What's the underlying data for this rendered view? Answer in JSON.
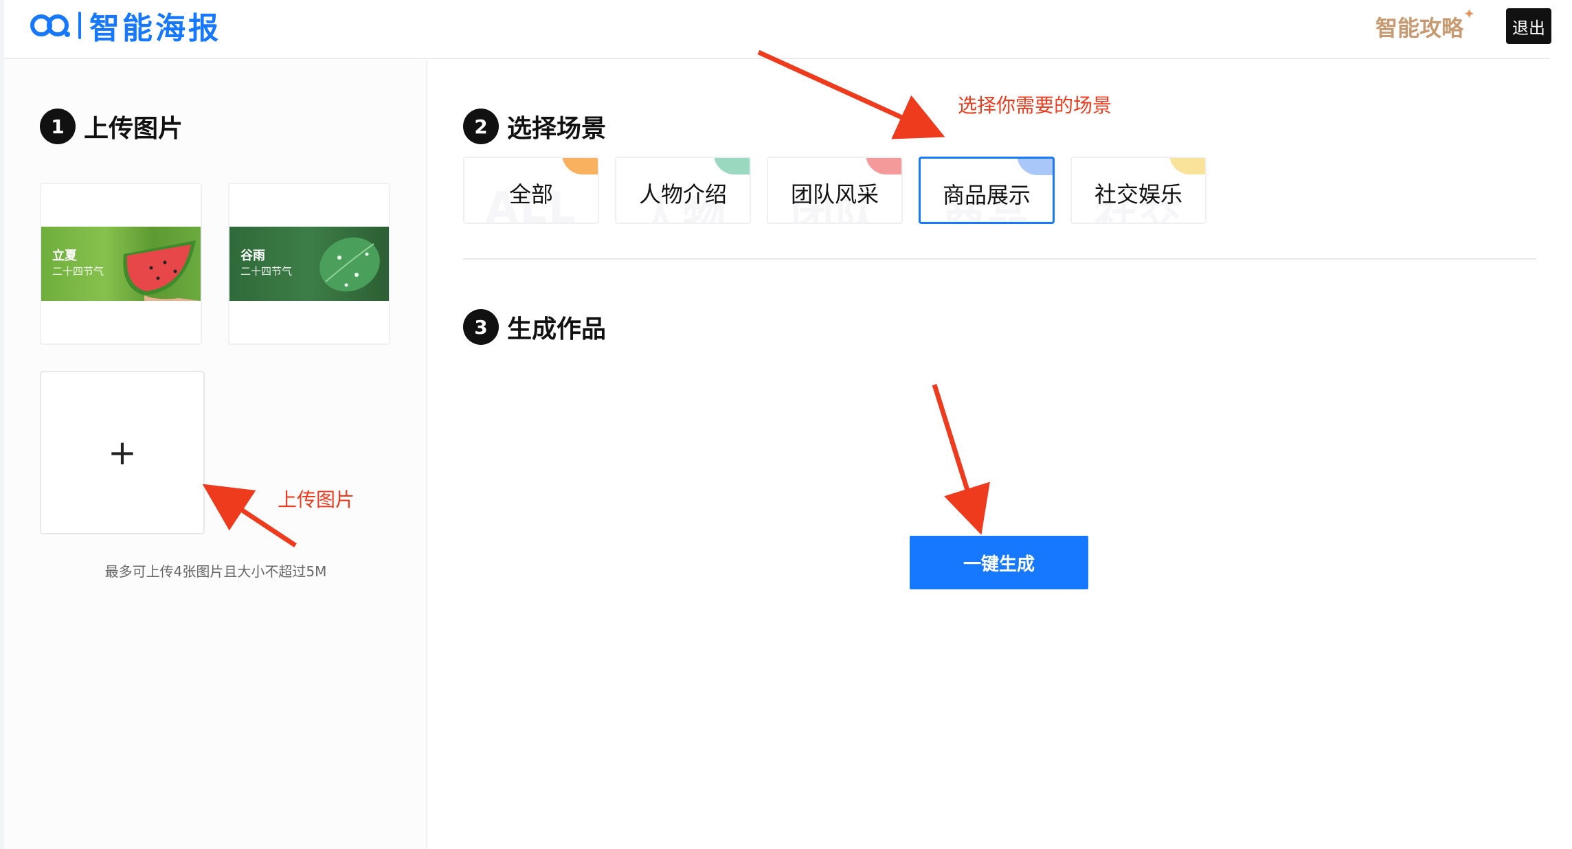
{
  "header": {
    "logo_text": "智能海报",
    "guide_label": "智能攻略",
    "logout_label": "退出"
  },
  "colors": {
    "brand_blue": "#1677ff",
    "annotation_red": "#ee3a1d",
    "guide_orange": "#c89a72"
  },
  "upload": {
    "step": "1",
    "title": "上传图片",
    "thumbnails": [
      {
        "title": "立夏",
        "subtitle": "二十四节气"
      },
      {
        "title": "谷雨",
        "subtitle": "二十四节气"
      }
    ],
    "add_icon": "+",
    "hint": "最多可上传4张图片且大小不超过5M"
  },
  "scene": {
    "step": "2",
    "title": "选择场景",
    "cards": [
      {
        "label": "全部",
        "watermark": "ALL",
        "corner_color": "#f9b15f",
        "active": false
      },
      {
        "label": "人物介绍",
        "watermark": "人物",
        "corner_color": "#9bd8c0",
        "active": false
      },
      {
        "label": "团队风采",
        "watermark": "团队",
        "corner_color": "#f59a9a",
        "active": false
      },
      {
        "label": "商品展示",
        "watermark": "商品",
        "corner_color": "#a9c7f9",
        "active": true
      },
      {
        "label": "社交娱乐",
        "watermark": "社交",
        "corner_color": "#f9e39a",
        "active": false
      }
    ]
  },
  "generate": {
    "step": "3",
    "title": "生成作品",
    "button_label": "一键生成"
  },
  "annotations": {
    "choose_scene": "选择你需要的场景",
    "upload_image": "上传图片"
  }
}
